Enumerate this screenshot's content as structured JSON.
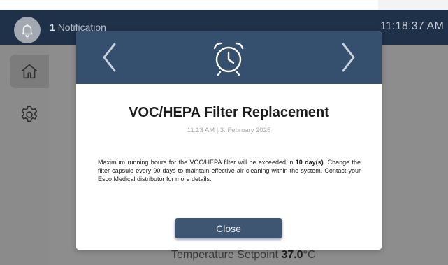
{
  "header": {
    "notification_count": "1",
    "notification_label": "Notification",
    "clock": "11:18:37 AM"
  },
  "sidebar": {
    "items": [
      {
        "name": "home",
        "icon": "home-icon",
        "active": true
      },
      {
        "name": "settings",
        "icon": "gear-icon",
        "active": false
      }
    ]
  },
  "main": {
    "setpoint_label": "Temperature Setpoint",
    "setpoint_value": "37.0",
    "setpoint_unit": "°C"
  },
  "modal": {
    "icon": "alarm-clock-icon",
    "title": "VOC/HEPA Filter Replacement",
    "timestamp": "11:13 AM | 3. February 2025",
    "body_part1": "Maximum running hours for the VOC/HEPA filter will be exceeded in ",
    "body_bold": "10 day(s)",
    "body_part2": ". Change the filter capsule every 90 days to maintain effective air-cleaning within the system. Contact your Esco Medical distributor for more details.",
    "close_label": "Close"
  },
  "colors": {
    "header_bg": "#1f3049",
    "modal_header_bg": "#35506e",
    "button_bg": "#3f5673",
    "overlay_gray": "#8b8b8b"
  }
}
